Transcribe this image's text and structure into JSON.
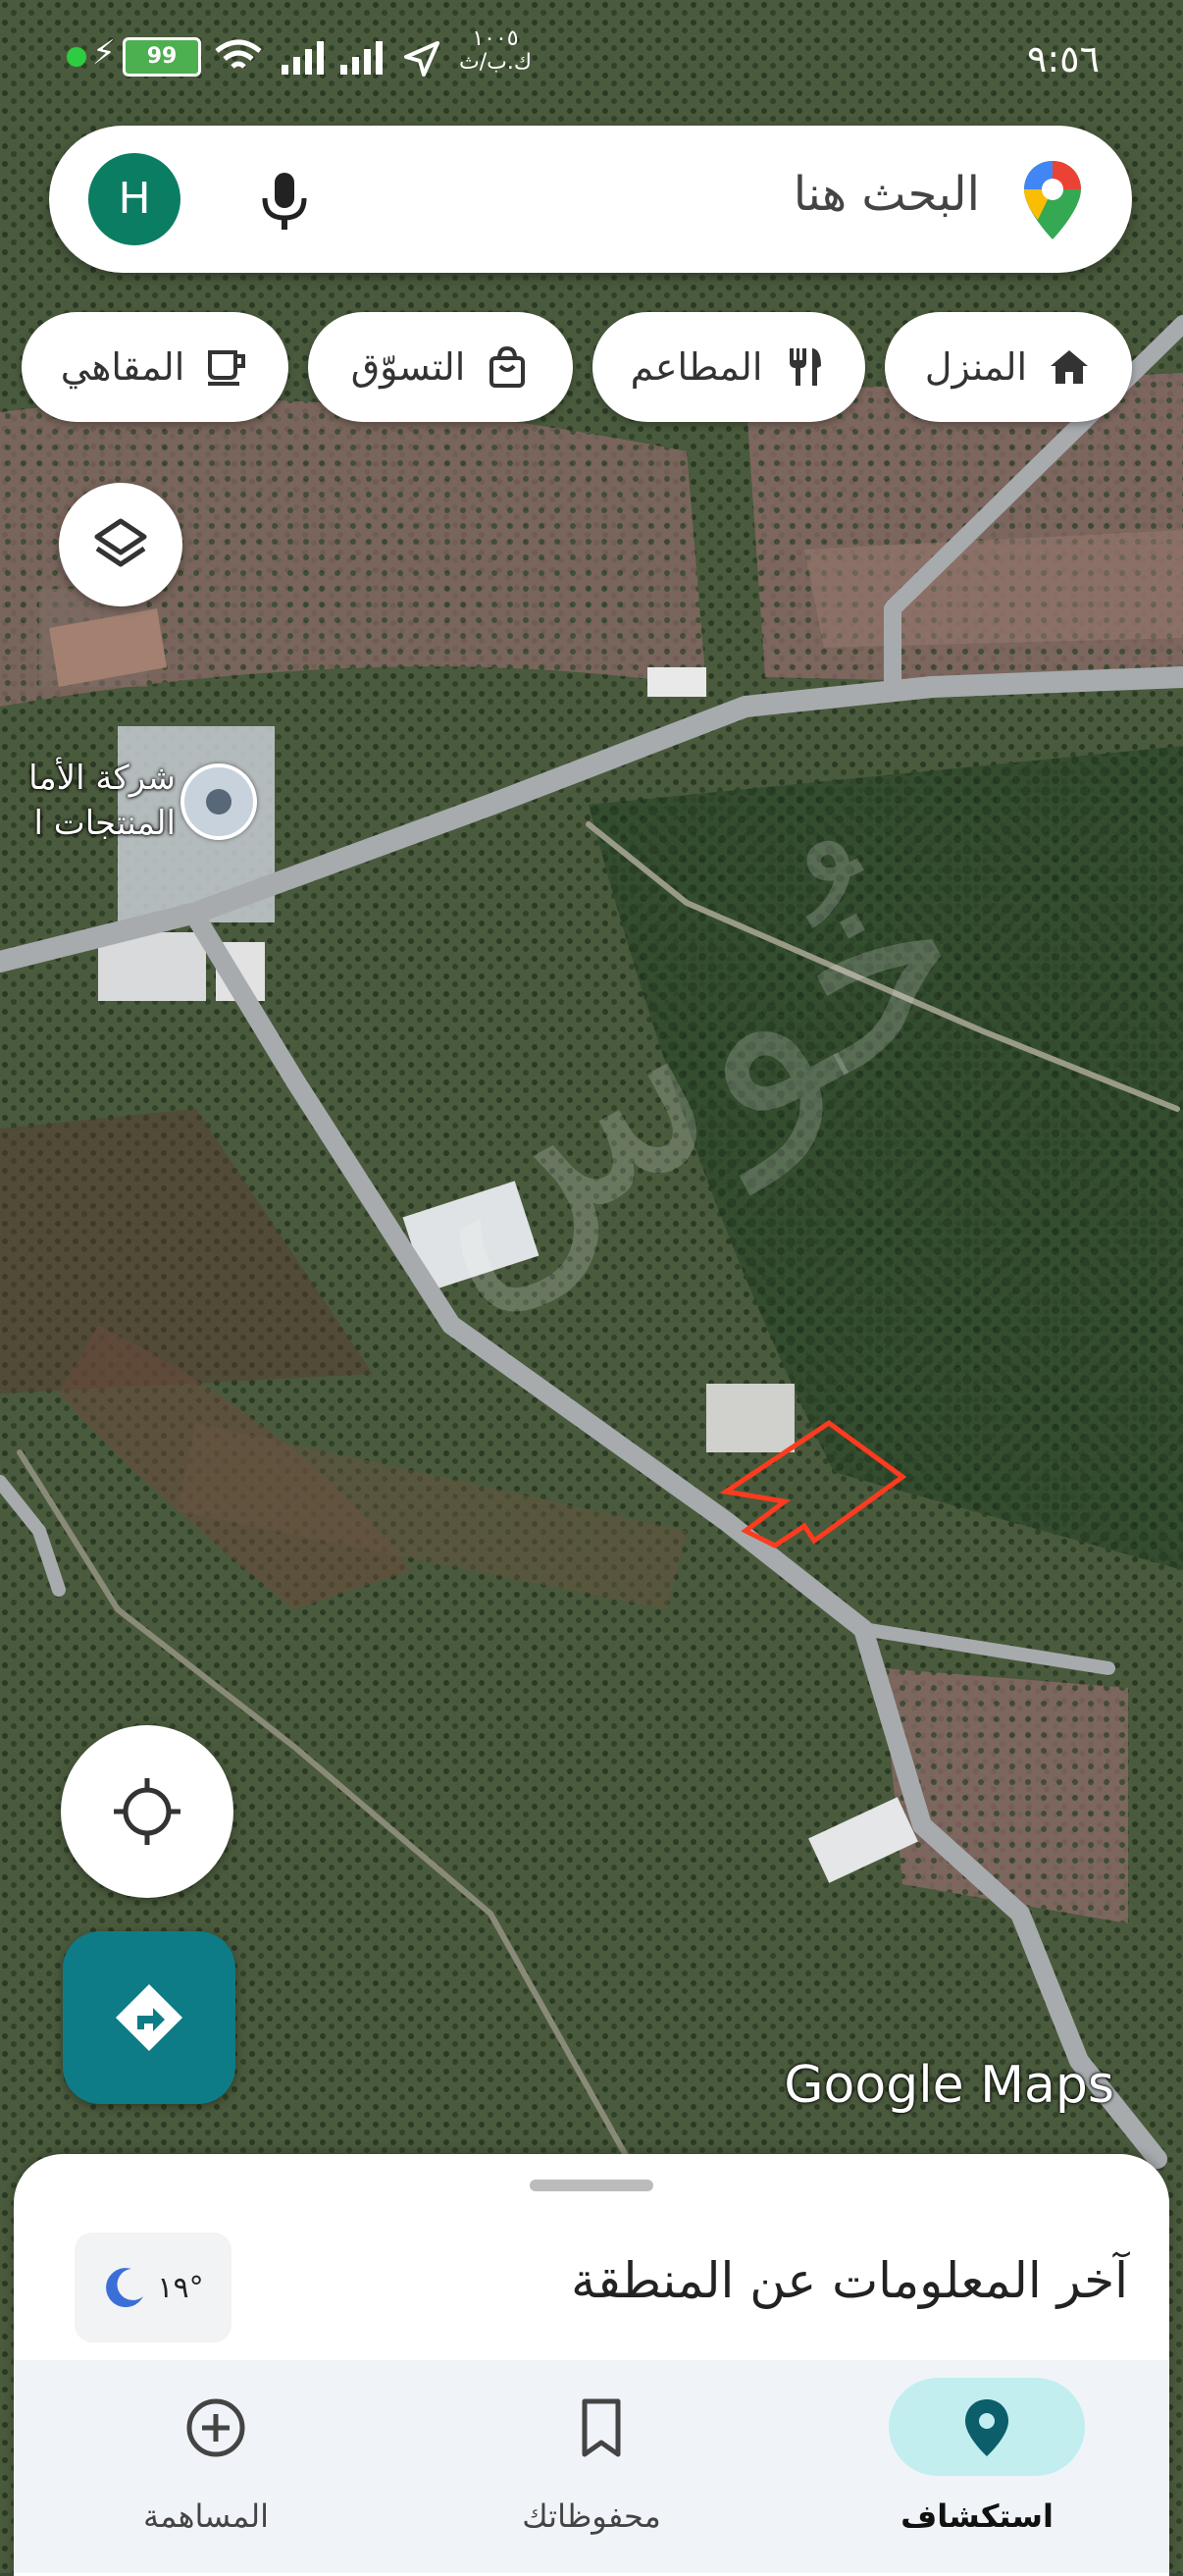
{
  "status_bar": {
    "time": "٩:٥٦",
    "battery": "99",
    "speed_value": "١٠٠٥",
    "speed_unit": "ك.ب/ث"
  },
  "search": {
    "placeholder": "البحث هنا",
    "avatar_initial": "H"
  },
  "chips": [
    {
      "label": "المنزل",
      "icon": "home-icon"
    },
    {
      "label": "المطاعم",
      "icon": "restaurant-icon"
    },
    {
      "label": "التسوّق",
      "icon": "shopping-bag-icon"
    },
    {
      "label": "المقاهي",
      "icon": "coffee-icon"
    }
  ],
  "map": {
    "place_label": "شركة الأما\nالمنتجات ا",
    "watermark": "خُوس",
    "attribution": "Google Maps"
  },
  "sheet": {
    "title": "آخر المعلومات عن المنطقة",
    "weather_temp": "١٩°"
  },
  "nav": {
    "explore": "استكشاف",
    "saved": "محفوظاتك",
    "contribute": "المساهمة"
  },
  "colors": {
    "accent": "#0e7c86",
    "avatar": "#0b7d62",
    "parcel_outline": "#ff3b1f",
    "nav_active": "#c2eef0"
  }
}
